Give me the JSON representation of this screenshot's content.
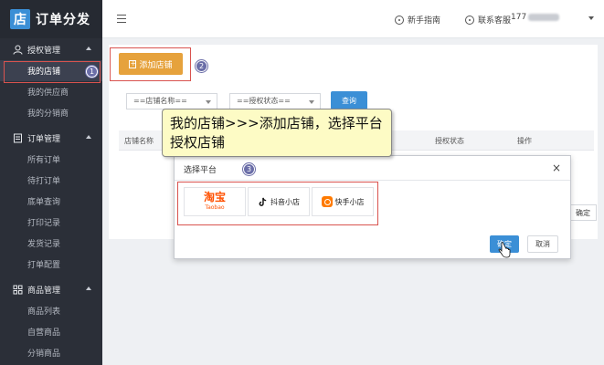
{
  "app": {
    "logo_char": "店",
    "title": "订单分发"
  },
  "sidebar": {
    "sections": [
      {
        "title": "授权管理",
        "items": [
          "我的店铺",
          "我的供应商",
          "我的分销商"
        ]
      },
      {
        "title": "订单管理",
        "items": [
          "所有订单",
          "待打订单",
          "底单查询",
          "打印记录",
          "发货记录",
          "打单配置"
        ]
      },
      {
        "title": "商品管理",
        "items": [
          "商品列表",
          "自营商品",
          "分销商品"
        ]
      }
    ]
  },
  "header": {
    "guide": "新手指南",
    "support": "联系客服",
    "user_prefix": "177"
  },
  "toolbar": {
    "add_shop": "添加店铺",
    "shop_name_select": "==店铺名称==",
    "auth_status_select": "==授权状态==",
    "query": "查询"
  },
  "table": {
    "columns": [
      "店铺名称",
      "授权状态",
      "操作"
    ]
  },
  "side_confirm": "确定",
  "tooltip": "我的店铺>>>添加店铺，选择平台授权店铺",
  "modal": {
    "title": "选择平台",
    "close": "×",
    "platforms": {
      "taobao_cn": "淘宝",
      "taobao_en": "Taobao",
      "douyin": "抖音小店",
      "kuaishou": "快手小店"
    },
    "ok": "确定",
    "cancel": "取消"
  },
  "badges": [
    "1",
    "2",
    "3"
  ],
  "colors": {
    "sidebar_bg": "#2b2f38",
    "primary": "#3b8fd6",
    "orange": "#e6a23c",
    "highlight_red": "#d9534f",
    "badge": "#6b6ea8",
    "tooltip_bg": "#fdfbc5"
  }
}
